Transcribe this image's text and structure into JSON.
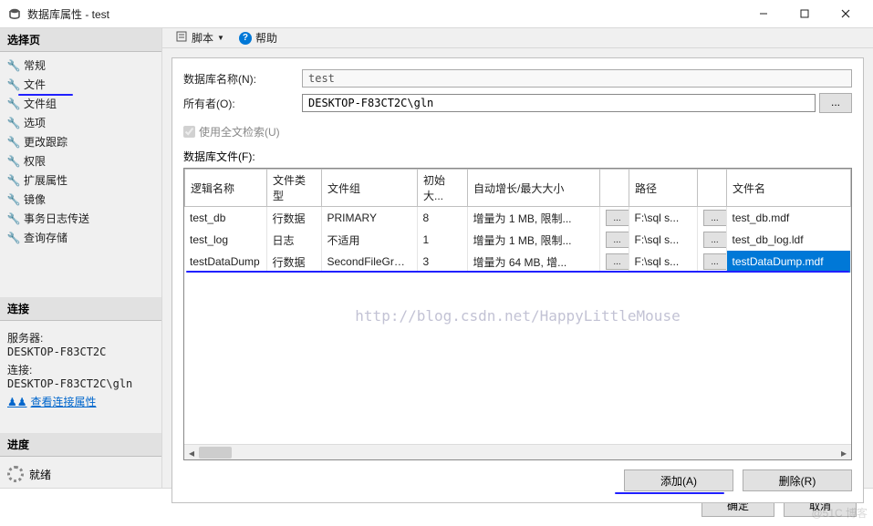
{
  "window": {
    "title": "数据库属性 - test"
  },
  "sidebar": {
    "select_page_header": "选择页",
    "items": [
      {
        "label": "常规"
      },
      {
        "label": "文件"
      },
      {
        "label": "文件组"
      },
      {
        "label": "选项"
      },
      {
        "label": "更改跟踪"
      },
      {
        "label": "权限"
      },
      {
        "label": "扩展属性"
      },
      {
        "label": "镜像"
      },
      {
        "label": "事务日志传送"
      },
      {
        "label": "查询存储"
      }
    ],
    "connection_header": "连接",
    "server_label": "服务器:",
    "server_value": "DESKTOP-F83CT2C",
    "conn_label": "连接:",
    "conn_value": "DESKTOP-F83CT2C\\gln",
    "view_props_link": "查看连接属性",
    "progress_header": "进度",
    "status_text": "就绪"
  },
  "toolbar": {
    "script_label": "脚本",
    "help_label": "帮助"
  },
  "form": {
    "db_name_label": "数据库名称(N):",
    "db_name_value": "test",
    "owner_label": "所有者(O):",
    "owner_value": "DESKTOP-F83CT2C\\gln",
    "owner_browse": "...",
    "fulltext_label": "使用全文检索(U)",
    "files_label": "数据库文件(F):"
  },
  "grid": {
    "columns": [
      "逻辑名称",
      "文件类型",
      "文件组",
      "初始大...",
      "自动增长/最大大小",
      "",
      "路径",
      "",
      "文件名"
    ],
    "rows": [
      {
        "name": "test_db",
        "type": "行数据",
        "group": "PRIMARY",
        "size": "8",
        "growth": "增量为 1 MB, 限制...",
        "path": "F:\\sql s...",
        "file": "test_db.mdf"
      },
      {
        "name": "test_log",
        "type": "日志",
        "group": "不适用",
        "size": "1",
        "growth": "增量为 1 MB, 限制...",
        "path": "F:\\sql s...",
        "file": "test_db_log.ldf"
      },
      {
        "name": "testDataDump",
        "type": "行数据",
        "group": "SecondFileGroup",
        "size": "3",
        "growth": "增量为 64 MB, 增...",
        "path": "F:\\sql s...",
        "file": "testDataDump.mdf"
      }
    ],
    "cell_btn": "..."
  },
  "buttons": {
    "add": "添加(A)",
    "remove": "删除(R)",
    "ok": "确定",
    "cancel": "取消"
  },
  "watermark": "http://blog.csdn.net/HappyLittleMouse",
  "corner_wm": "@51C 博客"
}
